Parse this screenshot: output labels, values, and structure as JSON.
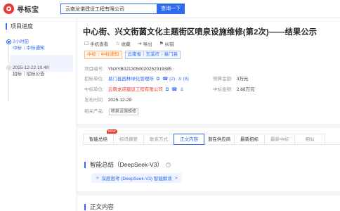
{
  "header": {
    "logo_text": "寻标宝",
    "search_value": "云南龙诺建设工程有限公司",
    "search_button": "查询一下"
  },
  "sidebar": {
    "title": "项目进度",
    "timeline": [
      {
        "time": "2小时前",
        "desc": "中标｜中标通知"
      },
      {
        "time": "2025-12-22 10:48",
        "desc": "招标｜招标公告"
      }
    ]
  },
  "detail": {
    "title": "中心街、兴文街菌文化主题街区喷泉设施维修(第2次)——结果公示",
    "actions": [
      {
        "icon": "phone-icon",
        "glyph": "☐",
        "label": "手机查看"
      },
      {
        "icon": "star-icon",
        "glyph": "☆",
        "label": "收藏"
      },
      {
        "icon": "export-icon",
        "glyph": "⇥",
        "label": "导出"
      },
      {
        "icon": "flag-icon",
        "glyph": "⚑",
        "label": "纠错"
      }
    ],
    "tags": {
      "type": "中标｜中标通知",
      "region": "云南省｜玉溪市｜易门县"
    },
    "fields": {
      "project_no_label": "项目编号:",
      "project_no": "YNXYB02130500202523193​85",
      "tenderer_label": "招标单位:",
      "tenderer": "易门县园林绿化管理所",
      "budget_label": "预算金额:",
      "budget": "3万元",
      "winner_label": "中标单位:",
      "winner": "云南龙诺建设工程有限公司",
      "bid_amount_label": "中标金额:",
      "bid_amount": "2.68万元",
      "publish_label": "发布时间:",
      "publish": "2025-12-29",
      "product_label": "相关产品:",
      "product": "喷泉设施维修",
      "contact_count_1": "(2)",
      "contact_count_2": "(8)"
    },
    "tabs": [
      {
        "label": "智能总结",
        "state": "dark",
        "badge": "NEW"
      },
      {
        "label": "标讯摘要",
        "state": "muted"
      },
      {
        "label": "联系方式",
        "state": "muted"
      },
      {
        "label": "正文内容",
        "state": "active"
      },
      {
        "label": "潜在供应商",
        "state": "dark"
      },
      {
        "label": "最新招标",
        "state": "dark"
      },
      {
        "label": "最新中标",
        "state": "muted"
      },
      {
        "label": "相似",
        "state": "muted"
      }
    ],
    "ai_section_title": "智能总结（DeepSeek-V3）",
    "ai_help": "?",
    "ai_button": "深度思考 (DeepSeek-V3) 智能解读",
    "ai_button_arrow": ">",
    "content_section_title": "正文内容"
  }
}
